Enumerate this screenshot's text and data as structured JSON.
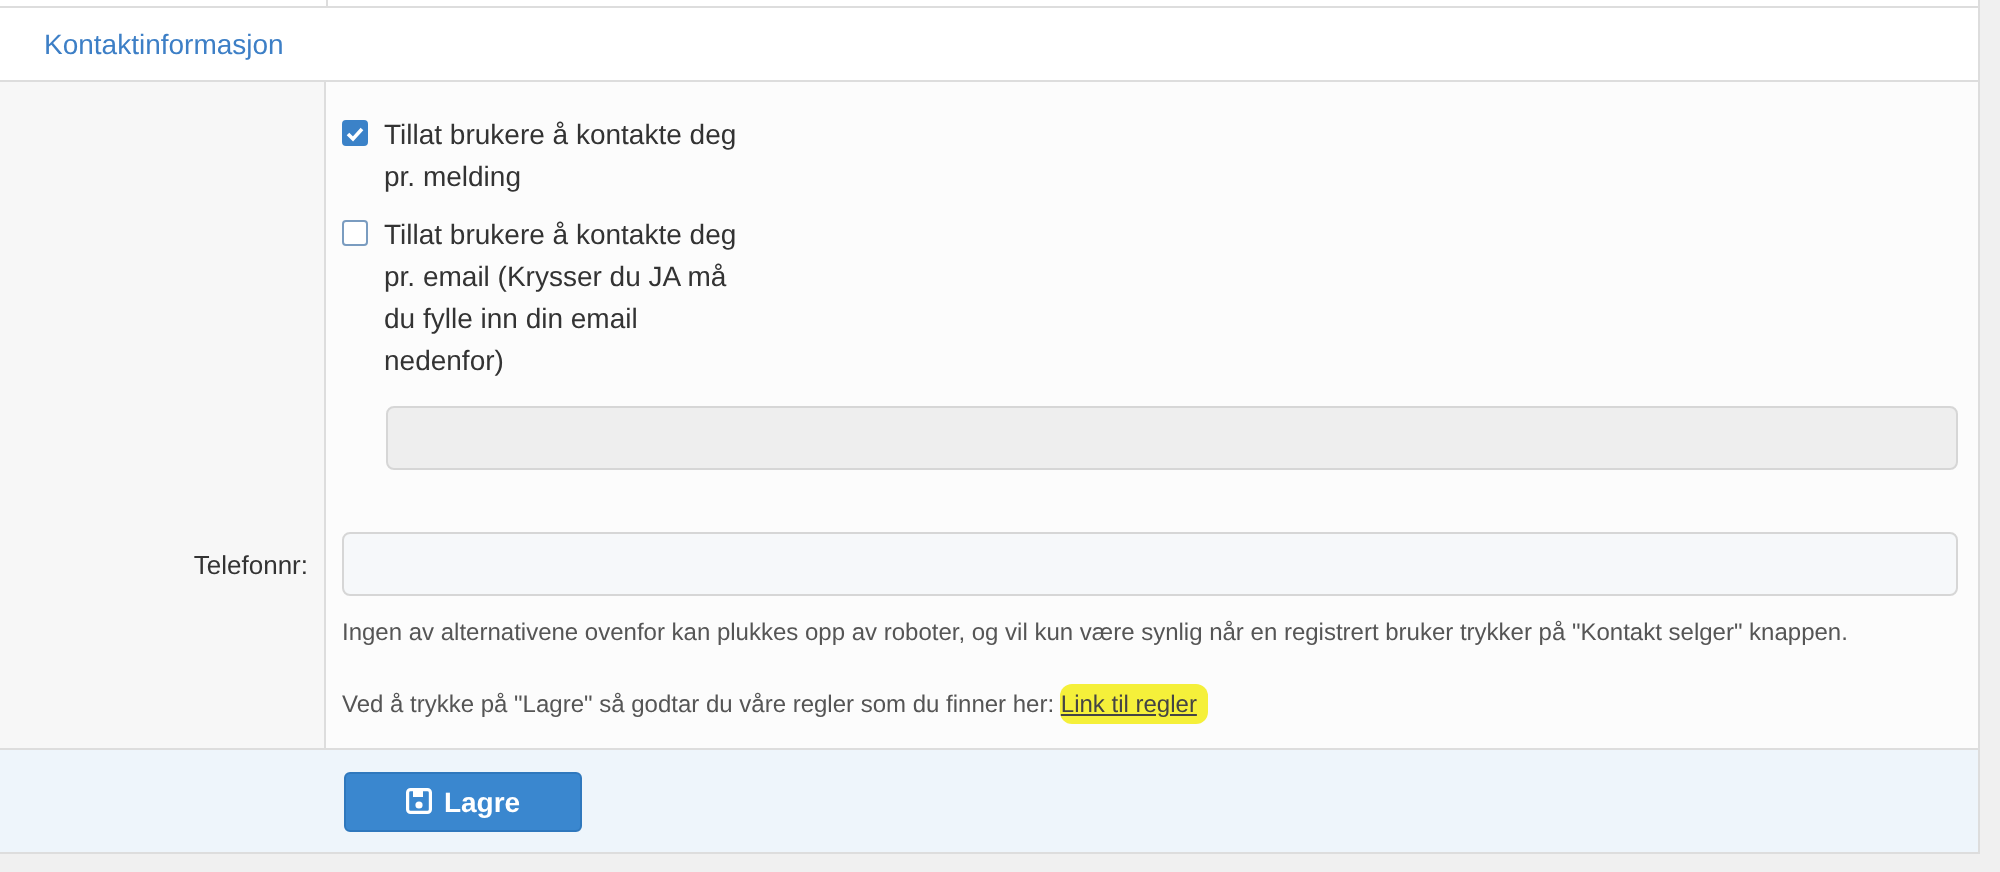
{
  "section": {
    "title": "Kontaktinformasjon"
  },
  "options": [
    {
      "label": "Tillat brukere å kontakte deg pr. melding",
      "checked": true
    },
    {
      "label": "Tillat brukere å kontakte deg pr. email (Krysser du JA må du fylle inn din email nedenfor)",
      "checked": false
    }
  ],
  "email_field": {
    "disabled": true
  },
  "phone": {
    "label": "Telefonnr:"
  },
  "help_text": "Ingen av alternativene ovenfor kan plukkes opp av roboter, og vil kun være synlig når en registrert bruker trykker på \"Kontakt selger\" knappen.",
  "terms": {
    "text": "Ved å trykke på \"Lagre\" så godtar du våre regler som du finner her:",
    "link": "Link til regler",
    "highlighted": true
  },
  "save_button": {
    "label": "Lagre"
  }
}
